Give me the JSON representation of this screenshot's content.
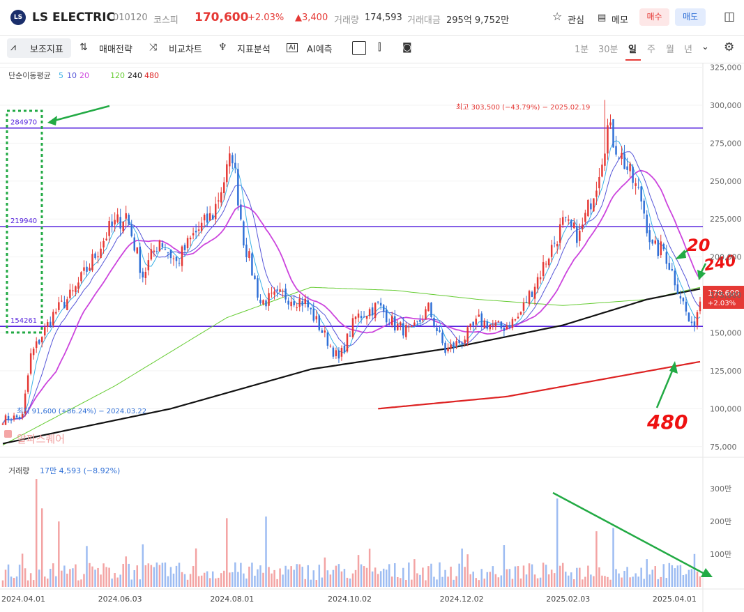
{
  "header": {
    "logo_text": "LS",
    "name": "LS ELECTRIC",
    "code": "010120",
    "market": "코스피",
    "price": "170,600",
    "change_pct": "+2.03%",
    "change_abs": "▲3,400",
    "volume_label": "거래량",
    "volume": "174,593",
    "amount_label": "거래대금",
    "amount": "295억 9,752만",
    "watch_label": "관심",
    "memo_label": "메모",
    "buy_label": "매수",
    "sell_label": "매도",
    "up_color": "#e53935",
    "down_color": "#2f6fd6"
  },
  "toolbar": {
    "indicators": "보조지표",
    "strategy": "매매전략",
    "compare": "비교차트",
    "analysis": "지표분석",
    "ai": "AI예측",
    "periods": [
      "1분",
      "30분",
      "일",
      "주",
      "월",
      "년"
    ],
    "active_period": "일"
  },
  "chart_data": {
    "type": "candlestick",
    "ma_legend": {
      "label": "단순이동평균",
      "periods": [
        "5",
        "10",
        "20",
        "120",
        "240",
        "480"
      ],
      "colors": [
        "#3ab0e6",
        "#5555d8",
        "#cc44dd",
        "#66cc33",
        "#111111",
        "#dd2222"
      ]
    },
    "price_ticks": [
      325000,
      300000,
      275000,
      250000,
      225000,
      200000,
      175000,
      150000,
      125000,
      100000,
      75000
    ],
    "price_tick_labels": [
      "325,000",
      "300,000",
      "275,000",
      "250,000",
      "225,000",
      "200,000",
      "175,000",
      "150,000",
      "125,000",
      "100,000",
      "75,000"
    ],
    "ylim": [
      68000,
      328000
    ],
    "x_tick_labels": [
      "2024.04.01",
      "2024.06.03",
      "2024.08.01",
      "2024.10.02",
      "2024.12.02",
      "2025.02.03",
      "2025.04.01"
    ],
    "x_tick_index": [
      0,
      42,
      82,
      124,
      164,
      202,
      240
    ],
    "n_days": 250,
    "current_price_tag": {
      "price": 170600,
      "label": "170,600",
      "change": "+2.03%"
    },
    "high_annotation": {
      "text": "최고 303,500 (−43.79%) − 2025.02.19",
      "value": 303500,
      "index": 215
    },
    "low_annotation": {
      "text": "최저 91,600 (+86.24%) − 2024.03.22",
      "value": 91600
    },
    "horizontal_lines": [
      {
        "value": 284970,
        "label": "284970"
      },
      {
        "value": 219940,
        "label": "219940"
      },
      {
        "value": 154261,
        "label": "154261"
      }
    ],
    "price_anchors": [
      [
        0,
        93000
      ],
      [
        7,
        95000
      ],
      [
        10,
        135000
      ],
      [
        18,
        162000
      ],
      [
        25,
        176000
      ],
      [
        32,
        198000
      ],
      [
        38,
        218000
      ],
      [
        44,
        228000
      ],
      [
        50,
        188000
      ],
      [
        56,
        212000
      ],
      [
        62,
        196000
      ],
      [
        68,
        214000
      ],
      [
        75,
        228000
      ],
      [
        82,
        268000
      ],
      [
        86,
        212000
      ],
      [
        92,
        170000
      ],
      [
        100,
        175000
      ],
      [
        108,
        170000
      ],
      [
        115,
        148000
      ],
      [
        120,
        132000
      ],
      [
        126,
        160000
      ],
      [
        134,
        168000
      ],
      [
        140,
        155000
      ],
      [
        146,
        150000
      ],
      [
        152,
        166000
      ],
      [
        158,
        138000
      ],
      [
        164,
        145000
      ],
      [
        170,
        158000
      ],
      [
        178,
        153000
      ],
      [
        184,
        160000
      ],
      [
        192,
        190000
      ],
      [
        200,
        222000
      ],
      [
        206,
        214000
      ],
      [
        212,
        250000
      ],
      [
        216,
        285000
      ],
      [
        222,
        262000
      ],
      [
        228,
        238000
      ],
      [
        232,
        205000
      ],
      [
        236,
        205000
      ],
      [
        242,
        175000
      ],
      [
        246,
        152000
      ],
      [
        249,
        170600
      ]
    ],
    "ma120_anchors": [
      [
        0,
        76000
      ],
      [
        40,
        115000
      ],
      [
        80,
        160000
      ],
      [
        110,
        180000
      ],
      [
        140,
        178000
      ],
      [
        170,
        172000
      ],
      [
        200,
        168000
      ],
      [
        230,
        172000
      ],
      [
        249,
        180000
      ]
    ],
    "ma240_anchors": [
      [
        0,
        77000
      ],
      [
        60,
        100000
      ],
      [
        110,
        126000
      ],
      [
        160,
        140000
      ],
      [
        200,
        155000
      ],
      [
        230,
        172000
      ],
      [
        249,
        179000
      ]
    ],
    "ma480_anchors": [
      [
        134,
        100000
      ],
      [
        180,
        108000
      ],
      [
        210,
        118000
      ],
      [
        249,
        131000
      ]
    ],
    "volume": {
      "label": "거래량",
      "value_text": "17만 4,593 (−8.92%)",
      "ticks": [
        3000000,
        2000000,
        1000000
      ],
      "tick_labels": [
        "300만",
        "200만",
        "100만"
      ],
      "ylim": [
        0,
        3450000
      ],
      "spikes": [
        [
          0,
          200000
        ],
        [
          12,
          3300000
        ],
        [
          14,
          2400000
        ],
        [
          20,
          2000000
        ],
        [
          30,
          1250000
        ],
        [
          50,
          1300000
        ],
        [
          80,
          2100000
        ],
        [
          94,
          2150000
        ],
        [
          198,
          2700000
        ],
        [
          212,
          1700000
        ],
        [
          218,
          1800000
        ],
        [
          230,
          850000
        ],
        [
          246,
          550000
        ]
      ]
    },
    "watermark": "알파스퀘어",
    "annotations": [
      "20",
      "240",
      "480"
    ]
  }
}
